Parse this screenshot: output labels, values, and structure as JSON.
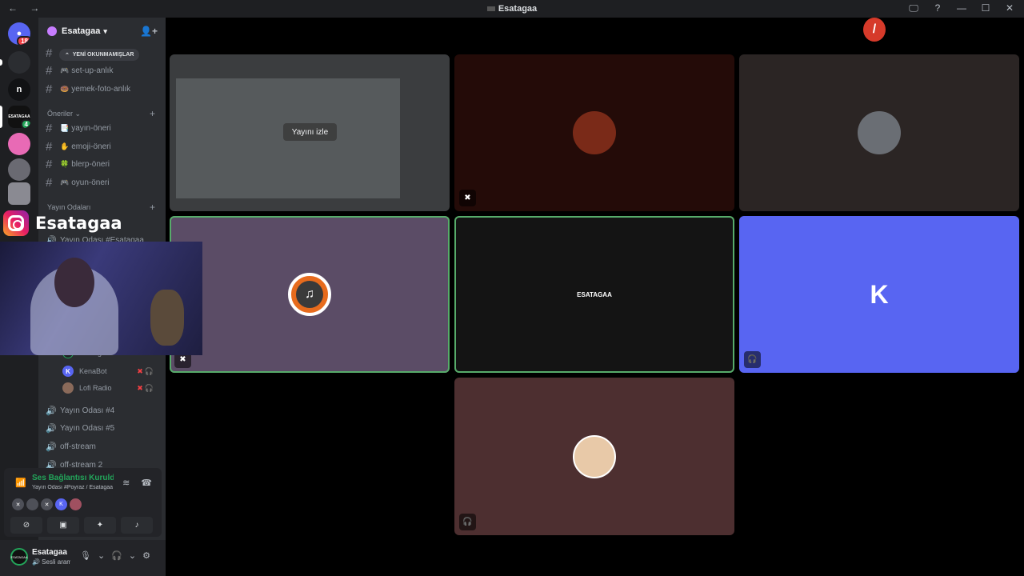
{
  "window": {
    "title": "Esatagaa",
    "nav_glyphs": "← →",
    "controls": [
      "🖵",
      "?",
      "—",
      "☐",
      "✕"
    ]
  },
  "guilds": [
    {
      "label": "",
      "badge": "18"
    },
    {
      "label": "",
      "badge": ""
    },
    {
      "label": "n",
      "badge": ""
    },
    {
      "label": "ESATAGAA",
      "badge": "4"
    },
    {
      "label": "",
      "badge": ""
    },
    {
      "label": "",
      "badge": ""
    },
    {
      "label": "",
      "badge": ""
    }
  ],
  "server": {
    "name": "Esatagaa",
    "unread_label": "YENİ OKUNMAMIŞLAR"
  },
  "channels_top": [
    {
      "emoji": "🎮",
      "name": "set-up-anlık"
    },
    {
      "emoji": "🍩",
      "name": "yemek-foto-anlık"
    }
  ],
  "category_oneriler": "Öneriler",
  "channels_oneriler": [
    {
      "emoji": "📑",
      "name": "yayın-öneri"
    },
    {
      "emoji": "✋",
      "name": "emoji-öneri"
    },
    {
      "emoji": "🍀",
      "name": "blerp-öneri"
    },
    {
      "emoji": "🎮",
      "name": "oyun-öneri"
    }
  ],
  "category_yayin": "Yayın Odaları",
  "voice_first": "Yayın Odası #Esatagaa",
  "voice_users": [
    {
      "name": "Esatagaa",
      "avatar_color": "#23a55a",
      "initial": ""
    },
    {
      "name": "KenaBot",
      "avatar_color": "#5865f2",
      "initial": "K"
    },
    {
      "name": "Lofi Radio",
      "avatar_color": "#8a6a5a",
      "initial": ""
    }
  ],
  "voice_channels": [
    "Yayın Odası #4",
    "Yayın Odası #5",
    "off-stream",
    "off-stream 2"
  ],
  "voice_panel": {
    "status": "Ses Bağlantısı Kuruldu",
    "sub": "Yayın Odası #Poyraz / Esatagaa"
  },
  "user": {
    "name": "Esatagaa",
    "status": "🔊 Sesli arama",
    "avatar_text": "ESATAGAA"
  },
  "stage": {
    "watch_label": "Yayını izle",
    "esatagaa_tile": "ESATAGAA",
    "kenabot_logo": "K"
  },
  "overlay": {
    "instagram_name": "Esatagaa"
  },
  "colors": {
    "accent_green": "#23a55a",
    "blurple": "#5865f2",
    "danger": "#f23f43"
  }
}
